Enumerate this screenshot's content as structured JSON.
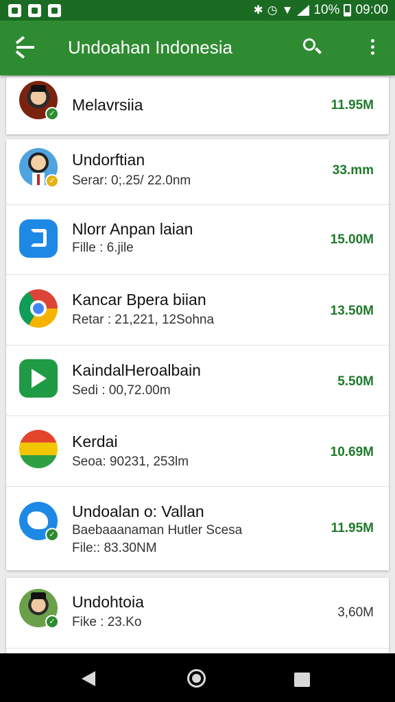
{
  "status_bar": {
    "battery": "10%",
    "time": "09:00",
    "icons": [
      "gallery-notification-icon",
      "message-notification-icon",
      "store-notification-icon",
      "bluetooth-icon",
      "alarm-icon",
      "wifi-icon",
      "signal-icon",
      "battery-icon"
    ]
  },
  "app_bar": {
    "title": "Undoahan Indonesia",
    "back_icon": "arrow-back-icon",
    "search_icon": "search-icon",
    "menu_icon": "overflow-menu-icon"
  },
  "top_item": {
    "name": "Melavrsiia",
    "size": "11.95M",
    "icon": "avatar-man-hat-icon"
  },
  "items": [
    {
      "name": "Undorftian",
      "detail": "Serar: 0;.25/ 22.0nm",
      "size": "33.mm",
      "icon": "avatar-man-suit-icon"
    },
    {
      "name": "Nlorr Anpan laian",
      "detail": "Fille : 6.jile",
      "size": "15.00M",
      "icon": "blue-chat-icon"
    },
    {
      "name": "Kancar Bpera biian",
      "detail": "Retar : 21,221, 12Sohna",
      "size": "13.50M",
      "icon": "chrome-icon"
    },
    {
      "name": "KaindalHeroalbain",
      "detail": "Sedi : 00,72.00m",
      "size": "5.50M",
      "icon": "green-share-icon"
    },
    {
      "name": "Kerdai",
      "detail": "Seoa: 90231, 253lm",
      "size": "10.69M",
      "icon": "striped-flag-icon"
    },
    {
      "name": "Undoalan o: Vallan",
      "detail": "Baebaaanaman Hutler Scesa",
      "detail2": "File:: 83.30NM",
      "size": "11.95M",
      "icon": "blue-map-icon"
    }
  ],
  "bottom_item": {
    "name": "Undohtoia",
    "detail": "Fike : 23.Ko",
    "size": "3,60M",
    "icon": "avatar-man-hat-icon"
  },
  "colors": {
    "primary": "#2e8b32",
    "status_bar": "#1b6b23",
    "size_text": "#1f7a2a"
  }
}
